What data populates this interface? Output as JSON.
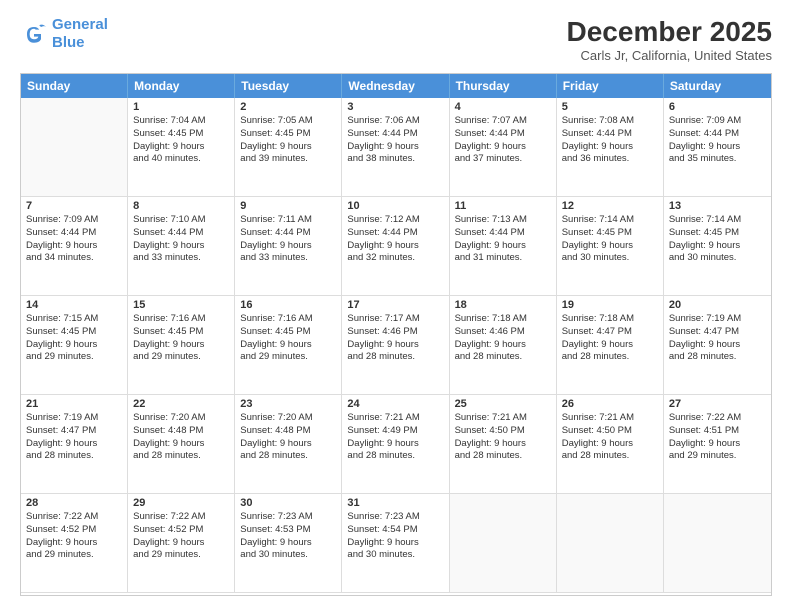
{
  "logo": {
    "line1": "General",
    "line2": "Blue"
  },
  "title": "December 2025",
  "subtitle": "Carls Jr, California, United States",
  "days": [
    "Sunday",
    "Monday",
    "Tuesday",
    "Wednesday",
    "Thursday",
    "Friday",
    "Saturday"
  ],
  "cells": [
    {
      "day": "",
      "empty": true
    },
    {
      "day": "1",
      "sunrise": "7:04 AM",
      "sunset": "4:45 PM",
      "daylight": "9 hours and 40 minutes."
    },
    {
      "day": "2",
      "sunrise": "7:05 AM",
      "sunset": "4:45 PM",
      "daylight": "9 hours and 39 minutes."
    },
    {
      "day": "3",
      "sunrise": "7:06 AM",
      "sunset": "4:44 PM",
      "daylight": "9 hours and 38 minutes."
    },
    {
      "day": "4",
      "sunrise": "7:07 AM",
      "sunset": "4:44 PM",
      "daylight": "9 hours and 37 minutes."
    },
    {
      "day": "5",
      "sunrise": "7:08 AM",
      "sunset": "4:44 PM",
      "daylight": "9 hours and 36 minutes."
    },
    {
      "day": "6",
      "sunrise": "7:09 AM",
      "sunset": "4:44 PM",
      "daylight": "9 hours and 35 minutes."
    },
    {
      "day": "7",
      "sunrise": "7:09 AM",
      "sunset": "4:44 PM",
      "daylight": "9 hours and 34 minutes."
    },
    {
      "day": "8",
      "sunrise": "7:10 AM",
      "sunset": "4:44 PM",
      "daylight": "9 hours and 33 minutes."
    },
    {
      "day": "9",
      "sunrise": "7:11 AM",
      "sunset": "4:44 PM",
      "daylight": "9 hours and 33 minutes."
    },
    {
      "day": "10",
      "sunrise": "7:12 AM",
      "sunset": "4:44 PM",
      "daylight": "9 hours and 32 minutes."
    },
    {
      "day": "11",
      "sunrise": "7:13 AM",
      "sunset": "4:44 PM",
      "daylight": "9 hours and 31 minutes."
    },
    {
      "day": "12",
      "sunrise": "7:14 AM",
      "sunset": "4:45 PM",
      "daylight": "9 hours and 30 minutes."
    },
    {
      "day": "13",
      "sunrise": "7:14 AM",
      "sunset": "4:45 PM",
      "daylight": "9 hours and 30 minutes."
    },
    {
      "day": "14",
      "sunrise": "7:15 AM",
      "sunset": "4:45 PM",
      "daylight": "9 hours and 29 minutes."
    },
    {
      "day": "15",
      "sunrise": "7:16 AM",
      "sunset": "4:45 PM",
      "daylight": "9 hours and 29 minutes."
    },
    {
      "day": "16",
      "sunrise": "7:16 AM",
      "sunset": "4:45 PM",
      "daylight": "9 hours and 29 minutes."
    },
    {
      "day": "17",
      "sunrise": "7:17 AM",
      "sunset": "4:46 PM",
      "daylight": "9 hours and 28 minutes."
    },
    {
      "day": "18",
      "sunrise": "7:18 AM",
      "sunset": "4:46 PM",
      "daylight": "9 hours and 28 minutes."
    },
    {
      "day": "19",
      "sunrise": "7:18 AM",
      "sunset": "4:47 PM",
      "daylight": "9 hours and 28 minutes."
    },
    {
      "day": "20",
      "sunrise": "7:19 AM",
      "sunset": "4:47 PM",
      "daylight": "9 hours and 28 minutes."
    },
    {
      "day": "21",
      "sunrise": "7:19 AM",
      "sunset": "4:47 PM",
      "daylight": "9 hours and 28 minutes."
    },
    {
      "day": "22",
      "sunrise": "7:20 AM",
      "sunset": "4:48 PM",
      "daylight": "9 hours and 28 minutes."
    },
    {
      "day": "23",
      "sunrise": "7:20 AM",
      "sunset": "4:48 PM",
      "daylight": "9 hours and 28 minutes."
    },
    {
      "day": "24",
      "sunrise": "7:21 AM",
      "sunset": "4:49 PM",
      "daylight": "9 hours and 28 minutes."
    },
    {
      "day": "25",
      "sunrise": "7:21 AM",
      "sunset": "4:50 PM",
      "daylight": "9 hours and 28 minutes."
    },
    {
      "day": "26",
      "sunrise": "7:21 AM",
      "sunset": "4:50 PM",
      "daylight": "9 hours and 28 minutes."
    },
    {
      "day": "27",
      "sunrise": "7:22 AM",
      "sunset": "4:51 PM",
      "daylight": "9 hours and 29 minutes."
    },
    {
      "day": "28",
      "sunrise": "7:22 AM",
      "sunset": "4:52 PM",
      "daylight": "9 hours and 29 minutes."
    },
    {
      "day": "29",
      "sunrise": "7:22 AM",
      "sunset": "4:52 PM",
      "daylight": "9 hours and 29 minutes."
    },
    {
      "day": "30",
      "sunrise": "7:23 AM",
      "sunset": "4:53 PM",
      "daylight": "9 hours and 30 minutes."
    },
    {
      "day": "31",
      "sunrise": "7:23 AM",
      "sunset": "4:54 PM",
      "daylight": "9 hours and 30 minutes."
    },
    {
      "day": "",
      "empty": true
    },
    {
      "day": "",
      "empty": true
    },
    {
      "day": "",
      "empty": true
    }
  ]
}
